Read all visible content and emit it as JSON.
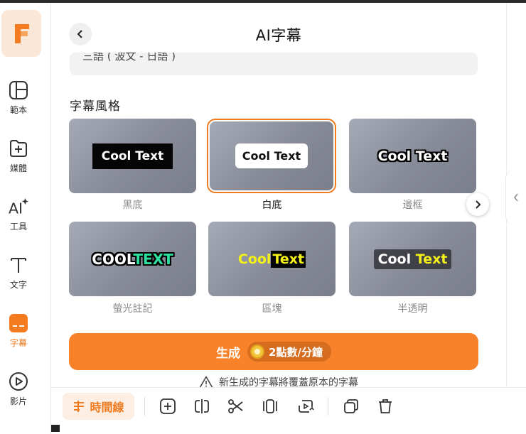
{
  "panel": {
    "title": "AI字幕",
    "language_value": "三語 ( 波文 - 日語 )",
    "section_title": "字幕風格"
  },
  "sidebar": {
    "items": [
      {
        "label": "範本",
        "icon": "template-icon"
      },
      {
        "label": "媒體",
        "icon": "media-icon"
      },
      {
        "label": "工具",
        "icon": "ai-tools-icon"
      },
      {
        "label": "文字",
        "icon": "text-icon"
      },
      {
        "label": "字幕",
        "icon": "subtitle-icon",
        "active": true
      },
      {
        "label": "影片",
        "icon": "video-icon"
      }
    ]
  },
  "styles": [
    {
      "label": "黑底",
      "preview": [
        "Cool Text"
      ],
      "selected": false
    },
    {
      "label": "白底",
      "preview": [
        "Cool Text"
      ],
      "selected": true
    },
    {
      "label": "邊框",
      "preview": [
        "Cool Text"
      ],
      "selected": false
    },
    {
      "label": "螢光註記",
      "preview": [
        "COOL",
        "TEXT"
      ],
      "selected": false
    },
    {
      "label": "區塊",
      "preview": [
        "Cool",
        "Text"
      ],
      "selected": false
    },
    {
      "label": "半透明",
      "preview": [
        "Cool",
        "Text"
      ],
      "selected": false
    }
  ],
  "generate": {
    "label": "生成",
    "cost": "2點數/分鐘"
  },
  "warning": "新生成的字幕將覆蓋原本的字幕",
  "toolbar": {
    "timeline_label": "時間線"
  },
  "colors": {
    "accent": "#f07a1e",
    "generate_button": "#f8822a"
  }
}
